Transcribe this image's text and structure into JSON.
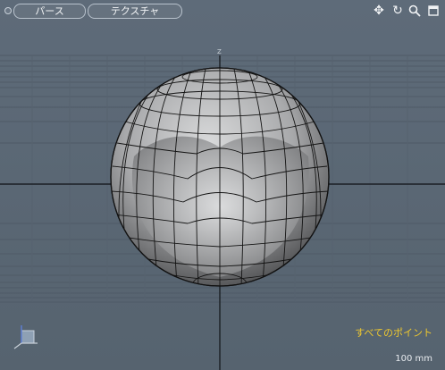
{
  "viewport": {
    "view_mode": "パース",
    "shading_mode": "テクスチャ",
    "selection_status": "すべてのポイント",
    "grid_scale": "100 mm",
    "top_axis_label": "Z"
  },
  "toolbar_icons": [
    "move-icon",
    "rotate-icon",
    "zoom-icon",
    "maximize-icon"
  ],
  "colors": {
    "background": "#5b6876",
    "grid_line": "#4b5663",
    "status_text": "#f0c92e",
    "mesh_wire": "#111111"
  }
}
